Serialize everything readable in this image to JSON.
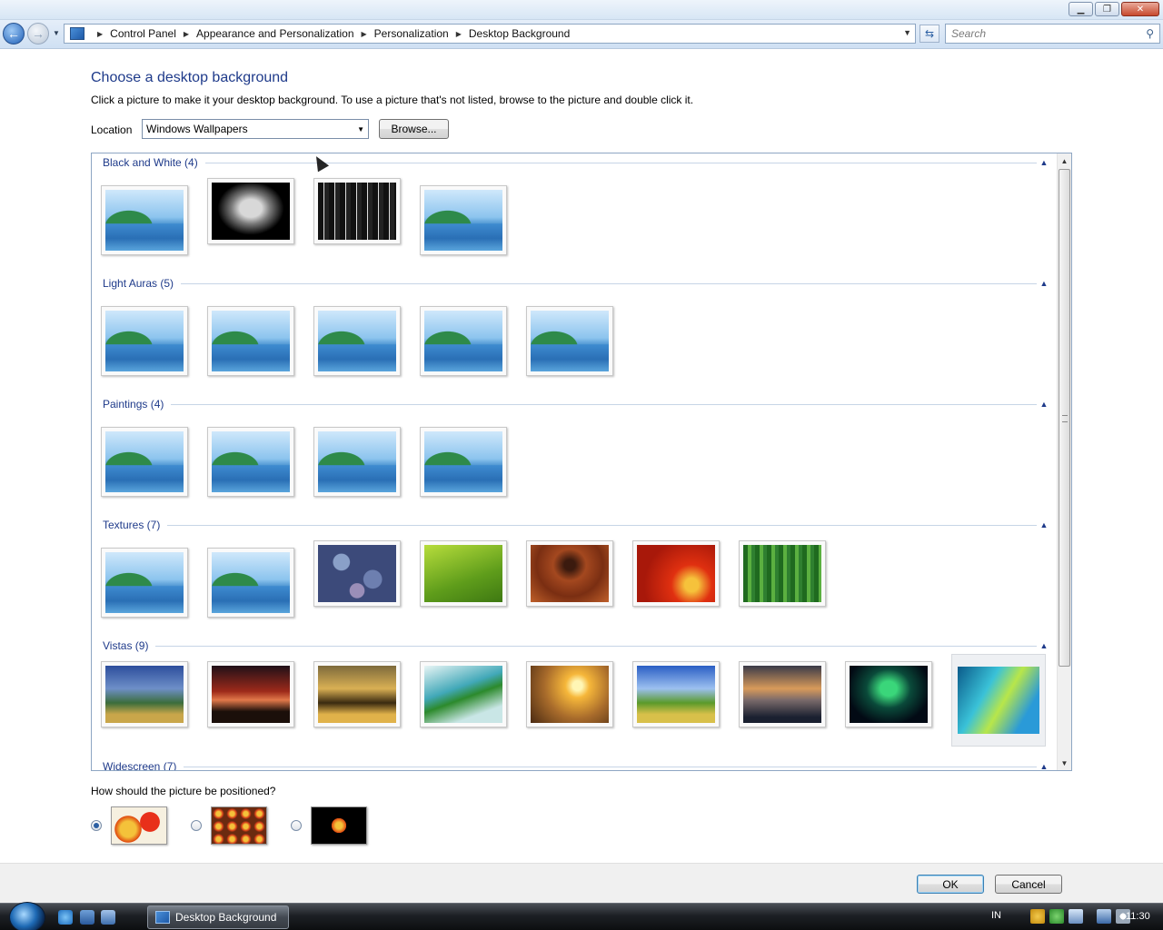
{
  "window": {
    "minimize_icon": "minimize-icon",
    "maximize_icon": "restore-icon",
    "close_icon": "close-icon"
  },
  "address_bar": {
    "breadcrumbs": [
      "Control Panel",
      "Appearance and Personalization",
      "Personalization",
      "Desktop Background"
    ],
    "search_placeholder": "Search"
  },
  "page": {
    "title": "Choose a desktop background",
    "description": "Click a picture to make it your desktop background. To use a picture that's not listed, browse to the picture and double click it.",
    "location_label": "Location",
    "location_value": "Windows Wallpapers",
    "browse_label": "Browse..."
  },
  "gallery": {
    "groups": [
      {
        "title": "Black and White (4)",
        "items": [
          "default",
          "leaf",
          "city",
          "default"
        ]
      },
      {
        "title": "Light Auras (5)",
        "items": [
          "default",
          "default",
          "default",
          "default",
          "default"
        ]
      },
      {
        "title": "Paintings (4)",
        "items": [
          "default",
          "default",
          "default",
          "default"
        ]
      },
      {
        "title": "Textures (7)",
        "items": [
          "default",
          "default",
          "stones",
          "leafgreen",
          "wood",
          "flower",
          "bamboo"
        ]
      },
      {
        "title": "Vistas (9)",
        "items": [
          "v1",
          "v2",
          "v3",
          "v4",
          "v5",
          "v6",
          "v7",
          "v8",
          "v9"
        ]
      },
      {
        "title": "Widescreen (7)",
        "items": []
      }
    ],
    "selected_item": "Vistas item 9"
  },
  "position": {
    "label": "How should the picture be positioned?",
    "options": [
      "fit-to-screen",
      "tile",
      "center"
    ],
    "selected": "fit-to-screen"
  },
  "footer": {
    "ok_label": "OK",
    "cancel_label": "Cancel"
  },
  "taskbar": {
    "task_label": "Desktop Background",
    "language": "IN",
    "clock": "11:30"
  },
  "colors": {
    "heading": "#1e3a8a",
    "taskbar": "#1d2025"
  }
}
